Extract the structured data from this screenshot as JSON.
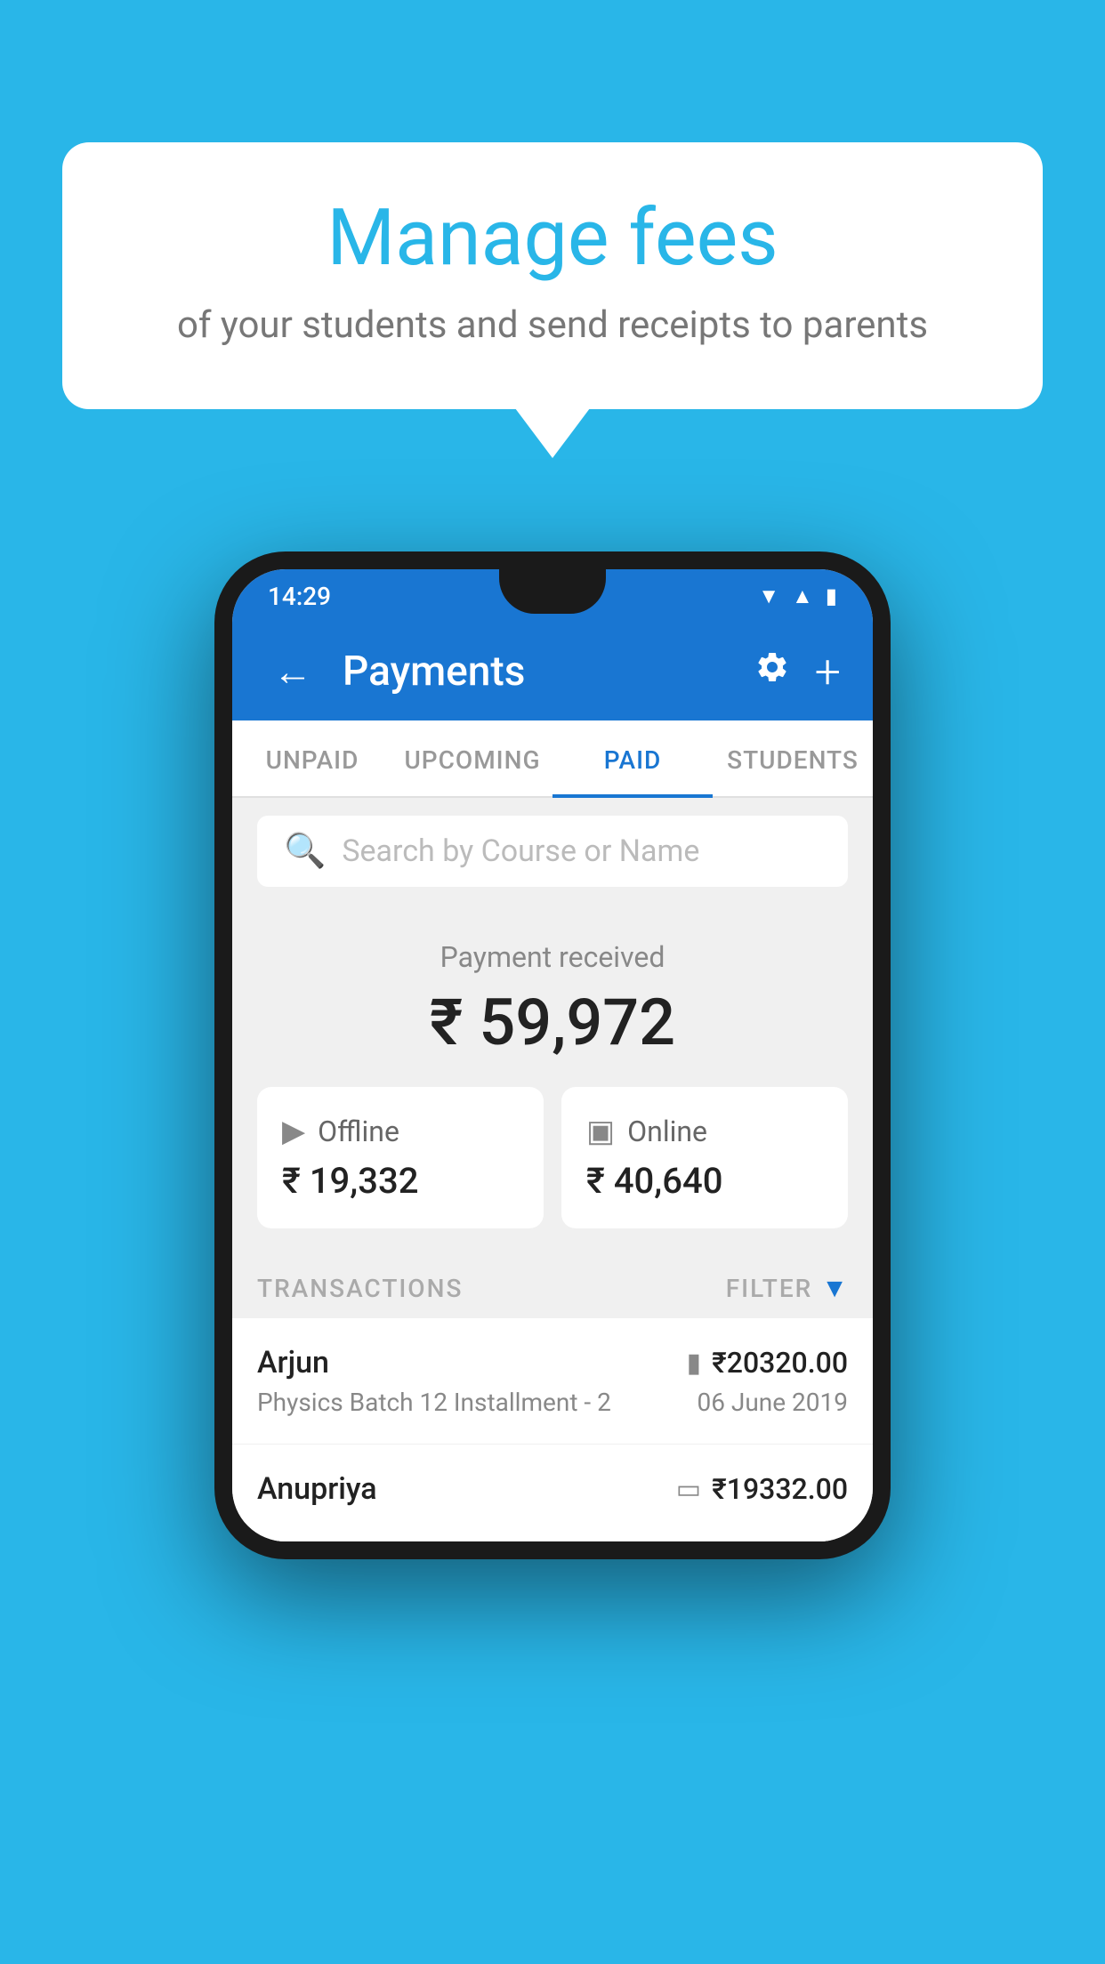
{
  "background_color": "#29b6e8",
  "bubble": {
    "title": "Manage fees",
    "subtitle": "of your students and send receipts to parents"
  },
  "status_bar": {
    "time": "14:29",
    "icons": [
      "wifi",
      "signal",
      "battery"
    ]
  },
  "app_bar": {
    "title": "Payments",
    "back_label": "←",
    "settings_label": "⚙",
    "add_label": "+"
  },
  "tabs": [
    {
      "label": "UNPAID",
      "active": false
    },
    {
      "label": "UPCOMING",
      "active": false
    },
    {
      "label": "PAID",
      "active": true
    },
    {
      "label": "STUDENTS",
      "active": false
    }
  ],
  "search": {
    "placeholder": "Search by Course or Name"
  },
  "payment_received": {
    "label": "Payment received",
    "amount": "₹ 59,972"
  },
  "payment_cards": [
    {
      "icon": "offline",
      "label": "Offline",
      "amount": "₹ 19,332"
    },
    {
      "icon": "online",
      "label": "Online",
      "amount": "₹ 40,640"
    }
  ],
  "transactions_section": {
    "label": "TRANSACTIONS",
    "filter_label": "FILTER"
  },
  "transactions": [
    {
      "name": "Arjun",
      "course": "Physics Batch 12 Installment - 2",
      "amount": "₹20320.00",
      "date": "06 June 2019",
      "payment_type": "online"
    },
    {
      "name": "Anupriya",
      "course": "",
      "amount": "₹19332.00",
      "date": "",
      "payment_type": "offline"
    }
  ]
}
